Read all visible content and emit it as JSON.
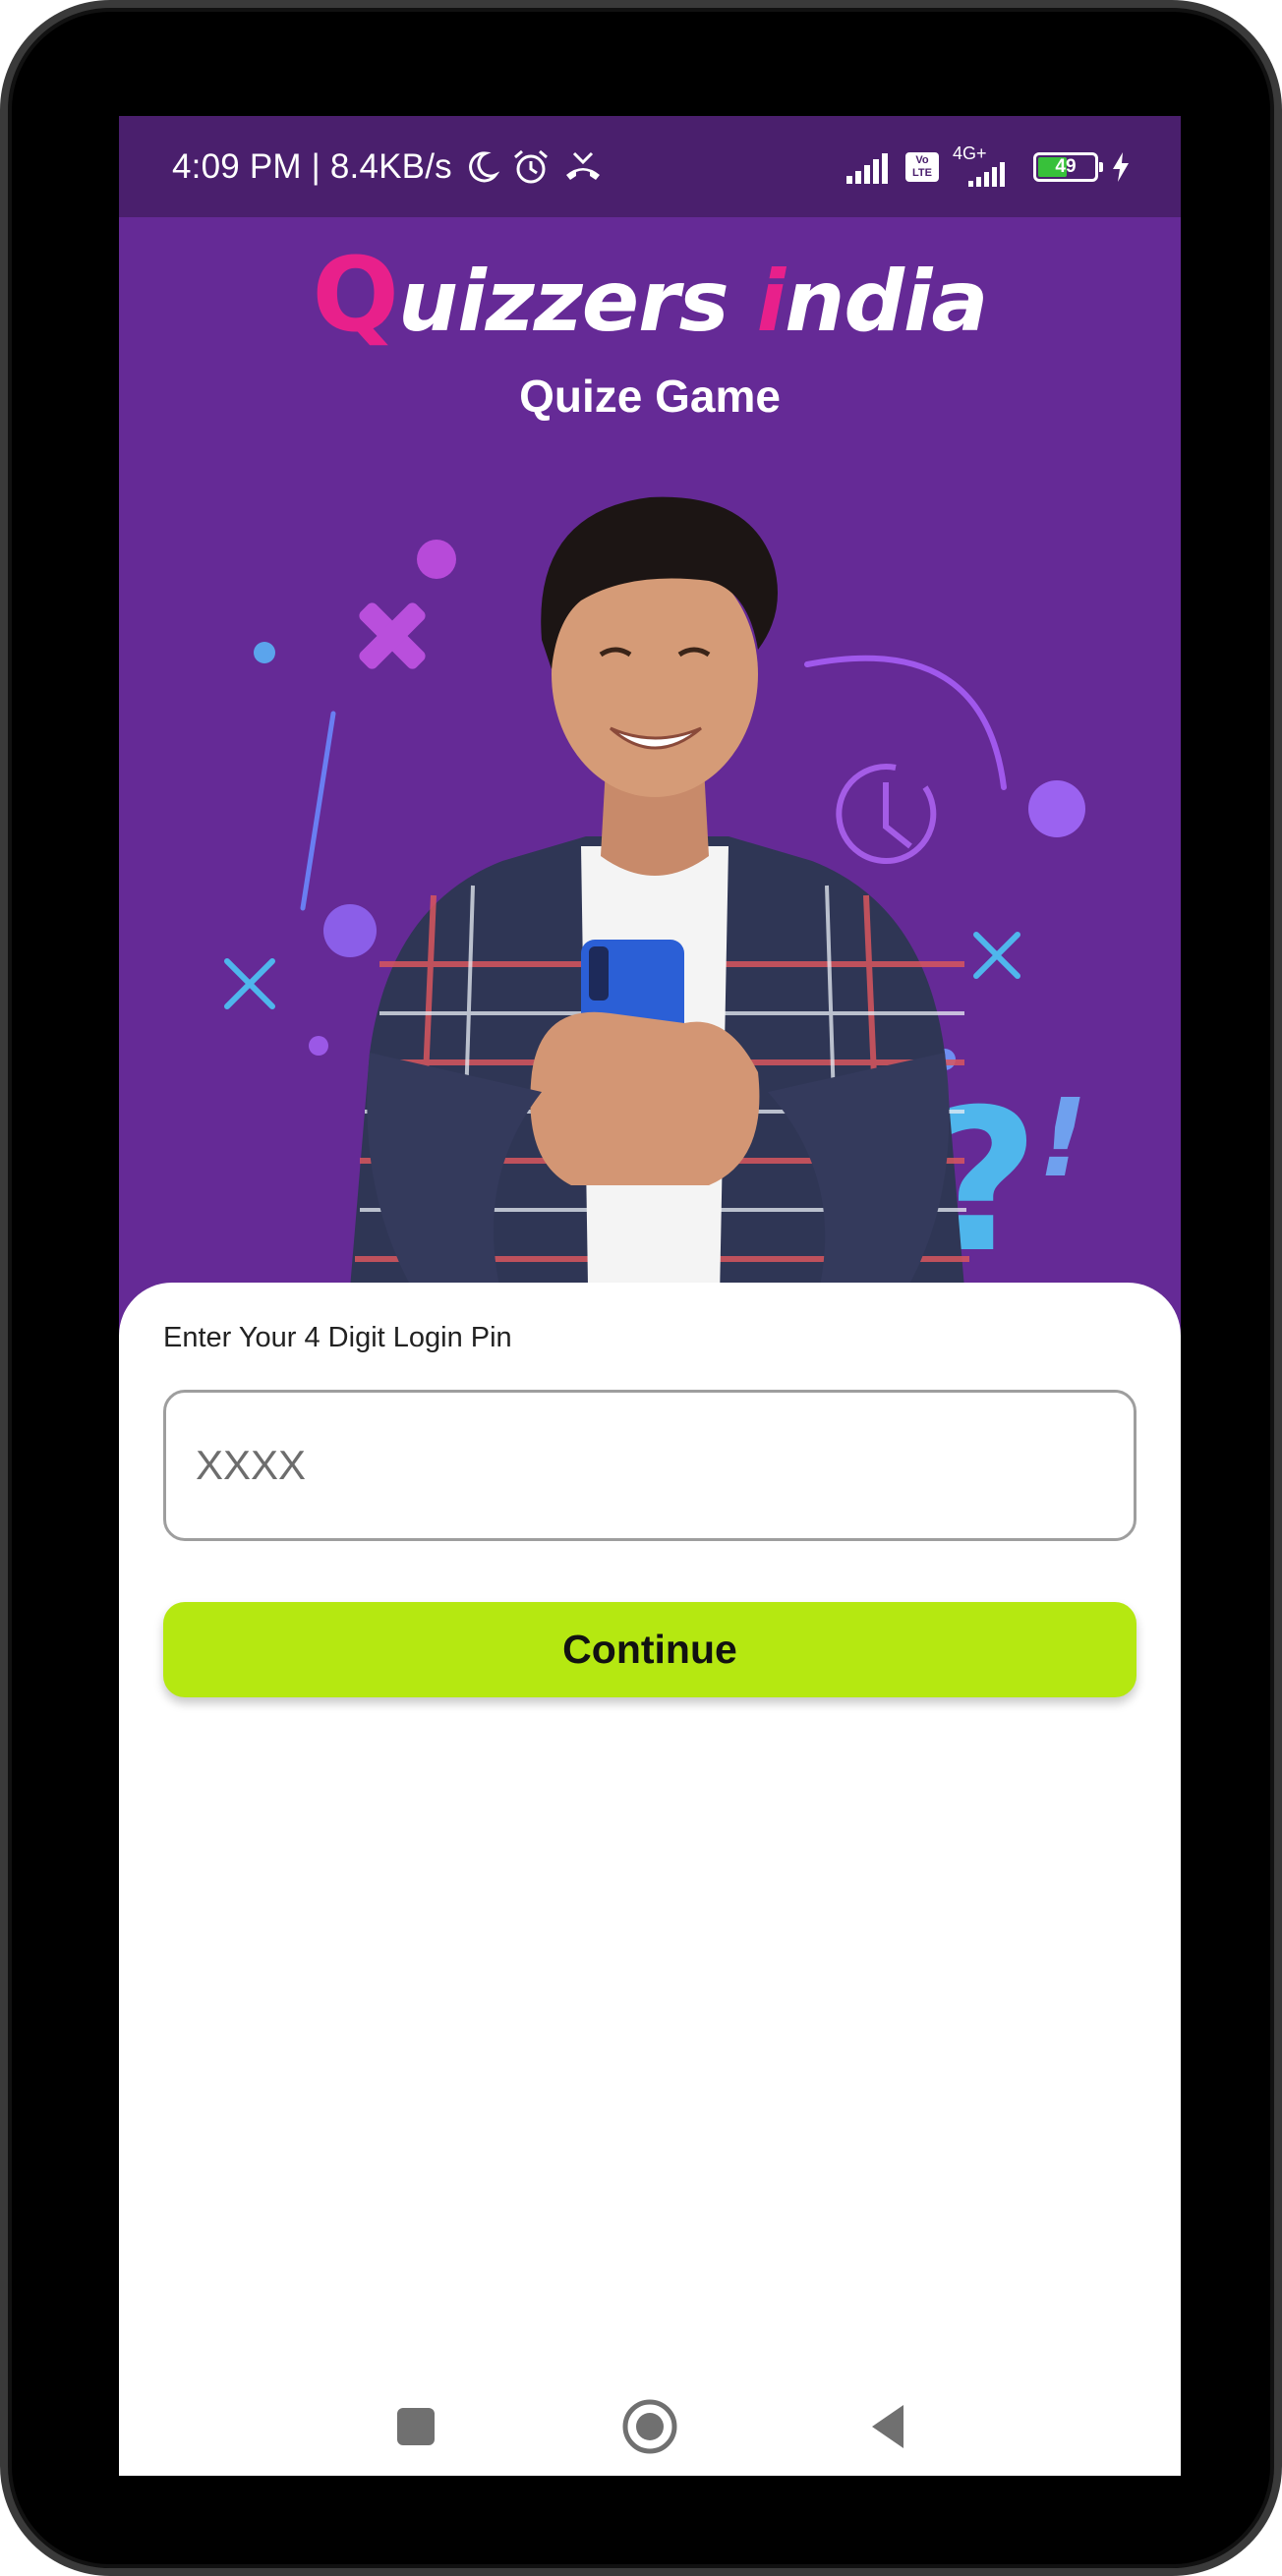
{
  "status_bar": {
    "time": "4:09 PM | 8.4KB/s",
    "network_label": "4G+",
    "volte_label": "Vo LTE",
    "battery_level": "49",
    "icons": [
      "moon-icon",
      "alarm-icon",
      "missed-call-icon",
      "signal-icon",
      "volte-icon",
      "signal-icon",
      "battery-icon",
      "charging-icon"
    ]
  },
  "header": {
    "logo_q": "Q",
    "logo_text1": "uizzers ",
    "logo_i": "i",
    "logo_text2": "ndia",
    "subtitle": "Quize Game"
  },
  "login": {
    "pin_label": "Enter Your 4 Digit Login Pin",
    "pin_placeholder": "XXXX",
    "pin_value": "",
    "continue_label": "Continue"
  },
  "nav": {
    "icons": [
      "recents-icon",
      "home-icon",
      "back-icon"
    ]
  },
  "colors": {
    "status_bar": "#4a1f6d",
    "hero_bg": "#652a96",
    "brand_pink": "#e8208b",
    "button": "#b5e811"
  }
}
